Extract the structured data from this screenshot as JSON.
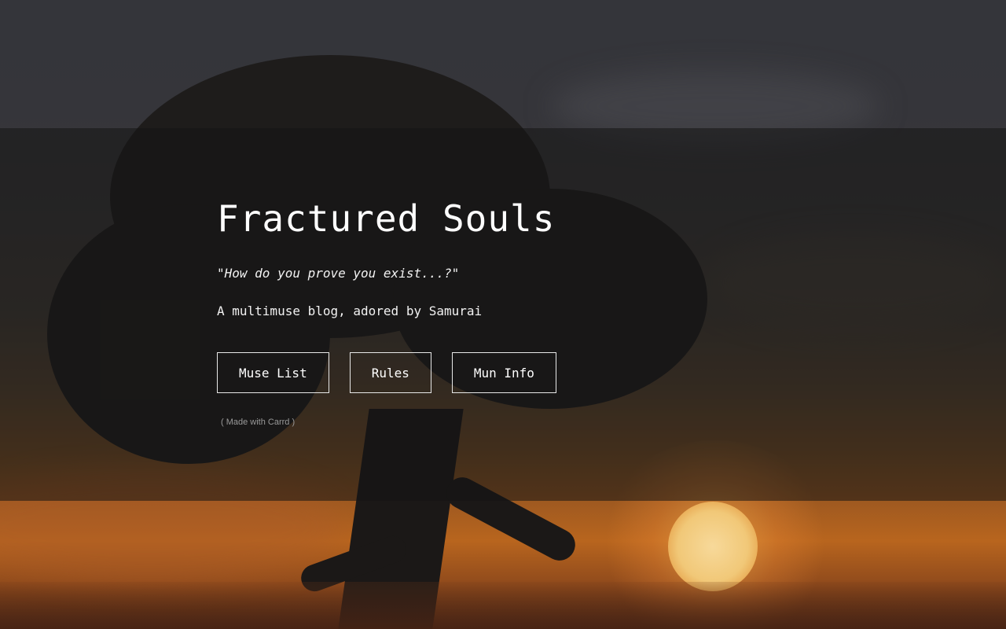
{
  "site": {
    "title": "Fractured Souls",
    "quote": "\"How do you prove you exist...?\"",
    "description": "A multimuse blog, adored by Samurai"
  },
  "buttons": [
    {
      "label": "Muse List"
    },
    {
      "label": "Rules"
    },
    {
      "label": "Mun Info"
    }
  ],
  "footer": {
    "credit": "( Made with Carrd )"
  },
  "background": {
    "scene": "tree-at-sunset",
    "colors": {
      "sky_top": "#34353a",
      "sunset_orange": "#b8651e",
      "sun": "#f1c878",
      "overlay": "#141414"
    }
  }
}
